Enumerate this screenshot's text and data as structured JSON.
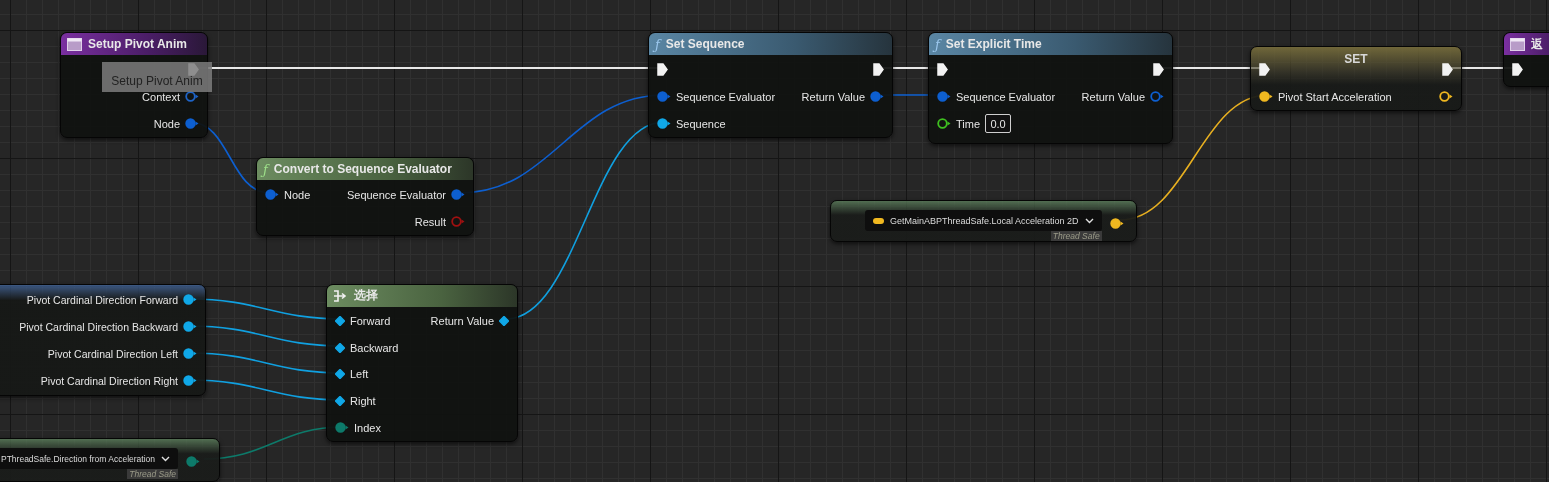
{
  "tooltip": "Setup Pivot Anim",
  "nodes": [
    {
      "kind": "event",
      "title": "Setup Pivot Anim",
      "outputs": [
        {
          "kind": "exec",
          "connected": true
        },
        {
          "kind": "data",
          "label": "Context",
          "color": "#1e64c8",
          "connected": false
        },
        {
          "kind": "data",
          "label": "Node",
          "color": "#0d5fd0",
          "connected": true
        }
      ]
    },
    {
      "kind": "pure",
      "glyph": "ƒ",
      "title": "Convert to Sequence Evaluator",
      "inputs": [
        {
          "kind": "data",
          "label": "Node",
          "color": "#0d5fd0",
          "connected": true
        }
      ],
      "outputs": [
        {
          "kind": "data",
          "label": "Sequence Evaluator",
          "color": "#0d5fd0",
          "connected": true
        },
        {
          "kind": "data",
          "label": "Result",
          "color": "#a01010",
          "connected": false
        }
      ]
    },
    {
      "kind": "function",
      "glyph": "ƒ",
      "title": "Set Sequence",
      "inputs": [
        {
          "kind": "exec",
          "connected": true
        },
        {
          "kind": "data",
          "label": "Sequence Evaluator",
          "color": "#0d5fd0",
          "connected": true
        },
        {
          "kind": "data",
          "label": "Sequence",
          "color": "#10a8e8",
          "connected": true
        }
      ],
      "outputs": [
        {
          "kind": "exec",
          "connected": true
        },
        {
          "kind": "data",
          "label": "Return Value",
          "color": "#0d5fd0",
          "connected": true
        }
      ]
    },
    {
      "kind": "function",
      "glyph": "ƒ",
      "title": "Set Explicit Time",
      "inputs": [
        {
          "kind": "exec",
          "connected": true
        },
        {
          "kind": "data",
          "label": "Sequence Evaluator",
          "color": "#0d5fd0",
          "connected": true
        },
        {
          "kind": "data",
          "label": "Time",
          "color": "#3fc020",
          "connected": false,
          "value": "0.0"
        }
      ],
      "outputs": [
        {
          "kind": "exec",
          "connected": true
        },
        {
          "kind": "data",
          "label": "Return Value",
          "color": "#0d5fd0",
          "connected": false
        }
      ]
    },
    {
      "kind": "set",
      "title": "SET",
      "inputs": [
        {
          "kind": "exec",
          "connected": true
        },
        {
          "kind": "data",
          "label": "Pivot Start Acceleration",
          "color": "#f0b820",
          "connected": true
        }
      ],
      "outputs": [
        {
          "kind": "exec",
          "connected": true
        },
        {
          "kind": "data",
          "color": "#f0b820",
          "connected": false
        }
      ]
    },
    {
      "kind": "event",
      "title": "返",
      "inputs": [
        {
          "kind": "exec",
          "connected": true
        }
      ]
    },
    {
      "kind": "variables",
      "outputs": [
        {
          "kind": "data",
          "label": "Pivot Cardinal Direction Forward",
          "color": "#10a8e8",
          "connected": true
        },
        {
          "kind": "data",
          "label": "Pivot Cardinal Direction Backward",
          "color": "#10a8e8",
          "connected": true
        },
        {
          "kind": "data",
          "label": "Pivot Cardinal Direction Left",
          "color": "#10a8e8",
          "connected": true
        },
        {
          "kind": "data",
          "label": "Pivot Cardinal Direction Right",
          "color": "#10a8e8",
          "connected": true
        }
      ]
    },
    {
      "kind": "select",
      "title": "选择",
      "inputs": [
        {
          "kind": "option",
          "label": "Forward",
          "color": "#10a8e8",
          "connected": true
        },
        {
          "kind": "option",
          "label": "Backward",
          "color": "#10a8e8",
          "connected": true
        },
        {
          "kind": "option",
          "label": "Left",
          "color": "#10a8e8",
          "connected": true
        },
        {
          "kind": "option",
          "label": "Right",
          "color": "#10a8e8",
          "connected": true
        },
        {
          "kind": "data",
          "label": "Index",
          "color": "#0d7a6a",
          "connected": true
        }
      ],
      "outputs": [
        {
          "kind": "option",
          "label": "Return Value",
          "color": "#10a8e8",
          "connected": true
        }
      ]
    },
    {
      "kind": "getter",
      "field": "GetMainABPThreadSafe.Local Acceleration 2D",
      "tag": "Thread Safe",
      "outputs": [
        {
          "kind": "data",
          "color": "#f0b820",
          "connected": true
        }
      ]
    },
    {
      "kind": "getter",
      "field": "PThreadSafe.Direction from Acceleration",
      "tag": "Thread Safe",
      "outputs": [
        {
          "kind": "data",
          "color": "#0d7a6a",
          "connected": true
        }
      ]
    }
  ]
}
